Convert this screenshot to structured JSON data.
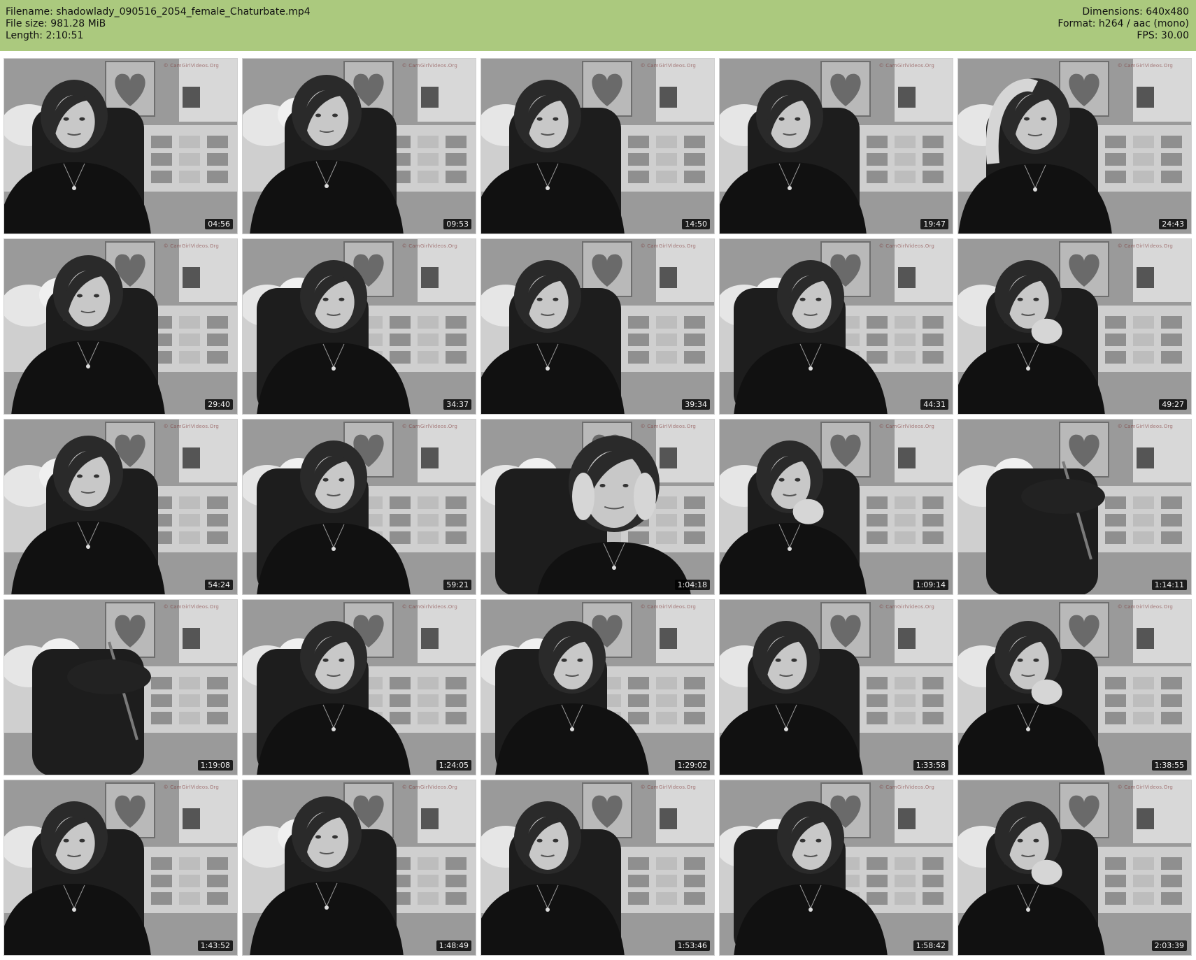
{
  "header": {
    "filename_label": "Filename: shadowlady_090516_2054_female_Chaturbate.mp4",
    "filesize_label": "File size: 981.28 MiB",
    "length_label": "Length: 2:10:51",
    "dimensions_label": "Dimensions: 640x480",
    "format_label": "Format: h264 / aac (mono)",
    "fps_label": "FPS: 30.00"
  },
  "colors": {
    "header_bg": "#abc97e",
    "timestamp_bg": "#000000"
  },
  "watermark": "© CamGirlVideos.Org",
  "thumbnails": [
    {
      "timestamp": "04:56",
      "variant": 0
    },
    {
      "timestamp": "09:53",
      "variant": 1
    },
    {
      "timestamp": "14:50",
      "variant": 2
    },
    {
      "timestamp": "19:47",
      "variant": 0
    },
    {
      "timestamp": "24:43",
      "variant": 3
    },
    {
      "timestamp": "29:40",
      "variant": 1
    },
    {
      "timestamp": "34:37",
      "variant": 4
    },
    {
      "timestamp": "39:34",
      "variant": 2
    },
    {
      "timestamp": "44:31",
      "variant": 4
    },
    {
      "timestamp": "49:27",
      "variant": 5
    },
    {
      "timestamp": "54:24",
      "variant": 1
    },
    {
      "timestamp": "59:21",
      "variant": 4
    },
    {
      "timestamp": "1:04:18",
      "variant": 6
    },
    {
      "timestamp": "1:09:14",
      "variant": 5
    },
    {
      "timestamp": "1:14:11",
      "variant": 7
    },
    {
      "timestamp": "1:19:08",
      "variant": 7
    },
    {
      "timestamp": "1:24:05",
      "variant": 4
    },
    {
      "timestamp": "1:29:02",
      "variant": 4
    },
    {
      "timestamp": "1:33:58",
      "variant": 2
    },
    {
      "timestamp": "1:38:55",
      "variant": 5
    },
    {
      "timestamp": "1:43:52",
      "variant": 0
    },
    {
      "timestamp": "1:48:49",
      "variant": 1
    },
    {
      "timestamp": "1:53:46",
      "variant": 2
    },
    {
      "timestamp": "1:58:42",
      "variant": 4
    },
    {
      "timestamp": "2:03:39",
      "variant": 5
    }
  ]
}
